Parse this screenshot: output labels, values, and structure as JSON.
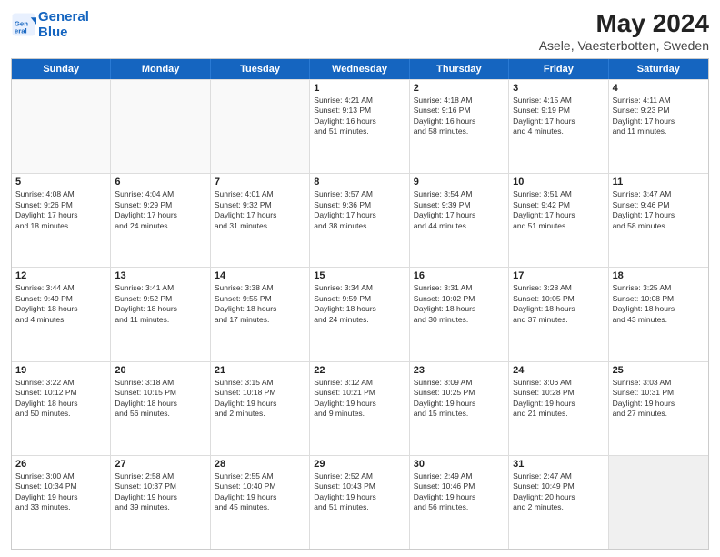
{
  "header": {
    "logo_line1": "General",
    "logo_line2": "Blue",
    "title": "May 2024",
    "subtitle": "Asele, Vaesterbotten, Sweden"
  },
  "days_of_week": [
    "Sunday",
    "Monday",
    "Tuesday",
    "Wednesday",
    "Thursday",
    "Friday",
    "Saturday"
  ],
  "weeks": [
    [
      {
        "day": "",
        "info": ""
      },
      {
        "day": "",
        "info": ""
      },
      {
        "day": "",
        "info": ""
      },
      {
        "day": "1",
        "info": "Sunrise: 4:21 AM\nSunset: 9:13 PM\nDaylight: 16 hours\nand 51 minutes."
      },
      {
        "day": "2",
        "info": "Sunrise: 4:18 AM\nSunset: 9:16 PM\nDaylight: 16 hours\nand 58 minutes."
      },
      {
        "day": "3",
        "info": "Sunrise: 4:15 AM\nSunset: 9:19 PM\nDaylight: 17 hours\nand 4 minutes."
      },
      {
        "day": "4",
        "info": "Sunrise: 4:11 AM\nSunset: 9:23 PM\nDaylight: 17 hours\nand 11 minutes."
      }
    ],
    [
      {
        "day": "5",
        "info": "Sunrise: 4:08 AM\nSunset: 9:26 PM\nDaylight: 17 hours\nand 18 minutes."
      },
      {
        "day": "6",
        "info": "Sunrise: 4:04 AM\nSunset: 9:29 PM\nDaylight: 17 hours\nand 24 minutes."
      },
      {
        "day": "7",
        "info": "Sunrise: 4:01 AM\nSunset: 9:32 PM\nDaylight: 17 hours\nand 31 minutes."
      },
      {
        "day": "8",
        "info": "Sunrise: 3:57 AM\nSunset: 9:36 PM\nDaylight: 17 hours\nand 38 minutes."
      },
      {
        "day": "9",
        "info": "Sunrise: 3:54 AM\nSunset: 9:39 PM\nDaylight: 17 hours\nand 44 minutes."
      },
      {
        "day": "10",
        "info": "Sunrise: 3:51 AM\nSunset: 9:42 PM\nDaylight: 17 hours\nand 51 minutes."
      },
      {
        "day": "11",
        "info": "Sunrise: 3:47 AM\nSunset: 9:46 PM\nDaylight: 17 hours\nand 58 minutes."
      }
    ],
    [
      {
        "day": "12",
        "info": "Sunrise: 3:44 AM\nSunset: 9:49 PM\nDaylight: 18 hours\nand 4 minutes."
      },
      {
        "day": "13",
        "info": "Sunrise: 3:41 AM\nSunset: 9:52 PM\nDaylight: 18 hours\nand 11 minutes."
      },
      {
        "day": "14",
        "info": "Sunrise: 3:38 AM\nSunset: 9:55 PM\nDaylight: 18 hours\nand 17 minutes."
      },
      {
        "day": "15",
        "info": "Sunrise: 3:34 AM\nSunset: 9:59 PM\nDaylight: 18 hours\nand 24 minutes."
      },
      {
        "day": "16",
        "info": "Sunrise: 3:31 AM\nSunset: 10:02 PM\nDaylight: 18 hours\nand 30 minutes."
      },
      {
        "day": "17",
        "info": "Sunrise: 3:28 AM\nSunset: 10:05 PM\nDaylight: 18 hours\nand 37 minutes."
      },
      {
        "day": "18",
        "info": "Sunrise: 3:25 AM\nSunset: 10:08 PM\nDaylight: 18 hours\nand 43 minutes."
      }
    ],
    [
      {
        "day": "19",
        "info": "Sunrise: 3:22 AM\nSunset: 10:12 PM\nDaylight: 18 hours\nand 50 minutes."
      },
      {
        "day": "20",
        "info": "Sunrise: 3:18 AM\nSunset: 10:15 PM\nDaylight: 18 hours\nand 56 minutes."
      },
      {
        "day": "21",
        "info": "Sunrise: 3:15 AM\nSunset: 10:18 PM\nDaylight: 19 hours\nand 2 minutes."
      },
      {
        "day": "22",
        "info": "Sunrise: 3:12 AM\nSunset: 10:21 PM\nDaylight: 19 hours\nand 9 minutes."
      },
      {
        "day": "23",
        "info": "Sunrise: 3:09 AM\nSunset: 10:25 PM\nDaylight: 19 hours\nand 15 minutes."
      },
      {
        "day": "24",
        "info": "Sunrise: 3:06 AM\nSunset: 10:28 PM\nDaylight: 19 hours\nand 21 minutes."
      },
      {
        "day": "25",
        "info": "Sunrise: 3:03 AM\nSunset: 10:31 PM\nDaylight: 19 hours\nand 27 minutes."
      }
    ],
    [
      {
        "day": "26",
        "info": "Sunrise: 3:00 AM\nSunset: 10:34 PM\nDaylight: 19 hours\nand 33 minutes."
      },
      {
        "day": "27",
        "info": "Sunrise: 2:58 AM\nSunset: 10:37 PM\nDaylight: 19 hours\nand 39 minutes."
      },
      {
        "day": "28",
        "info": "Sunrise: 2:55 AM\nSunset: 10:40 PM\nDaylight: 19 hours\nand 45 minutes."
      },
      {
        "day": "29",
        "info": "Sunrise: 2:52 AM\nSunset: 10:43 PM\nDaylight: 19 hours\nand 51 minutes."
      },
      {
        "day": "30",
        "info": "Sunrise: 2:49 AM\nSunset: 10:46 PM\nDaylight: 19 hours\nand 56 minutes."
      },
      {
        "day": "31",
        "info": "Sunrise: 2:47 AM\nSunset: 10:49 PM\nDaylight: 20 hours\nand 2 minutes."
      },
      {
        "day": "",
        "info": ""
      }
    ]
  ]
}
